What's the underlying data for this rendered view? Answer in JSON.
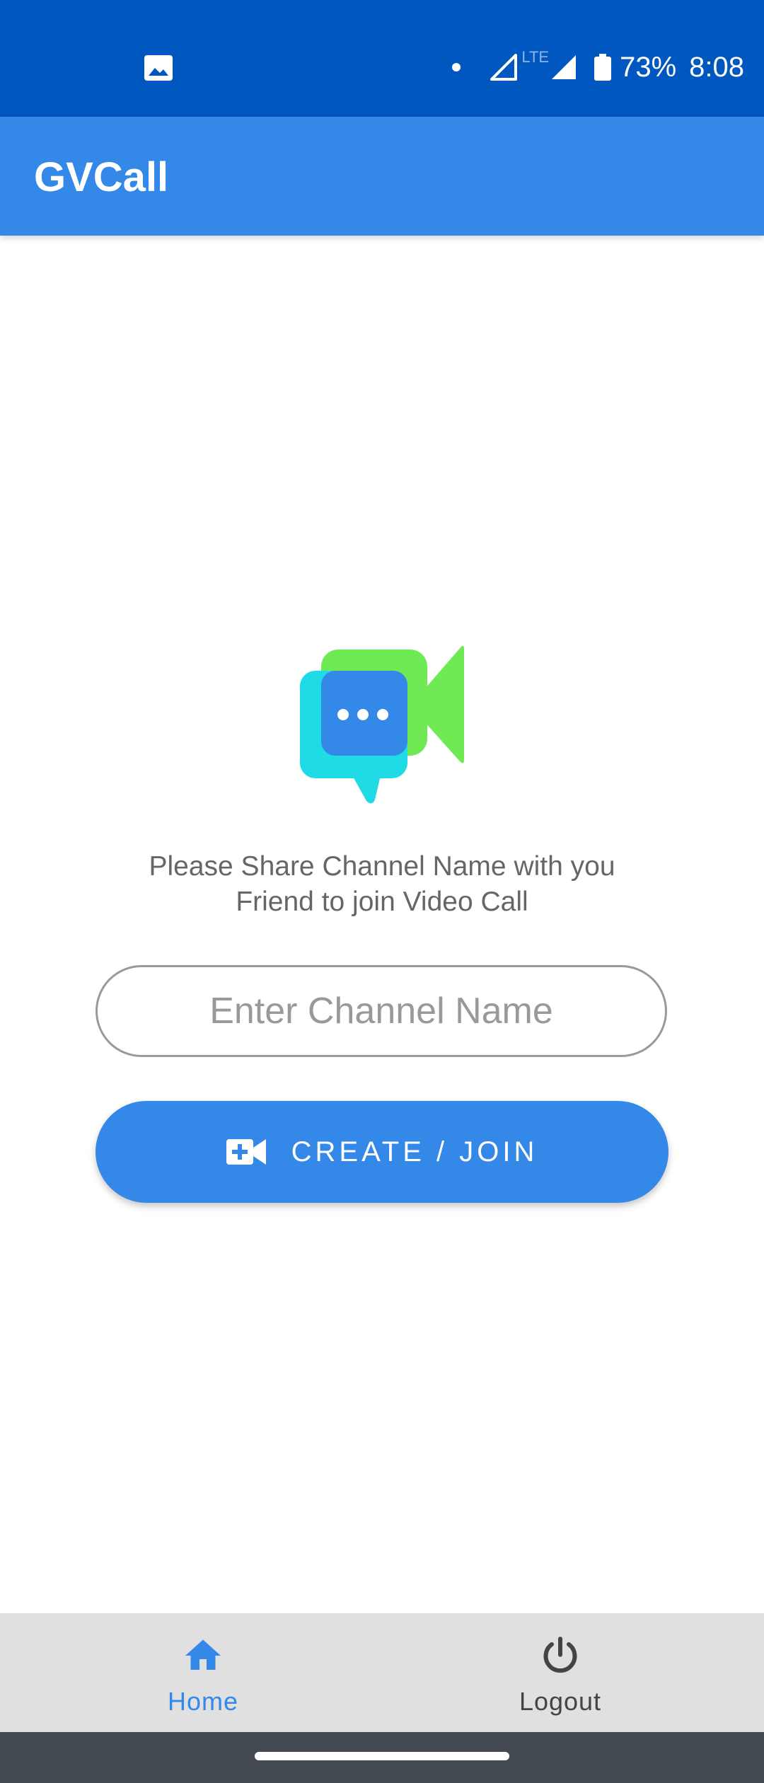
{
  "status_bar": {
    "network_type": "LTE",
    "battery_percent": "73%",
    "time": "8:08",
    "icons": [
      "gallery-icon",
      "notification-dot-icon",
      "cell-signal-icon",
      "cell-signal-icon",
      "battery-icon"
    ]
  },
  "app_bar": {
    "title": "GVCall"
  },
  "main": {
    "hero_icon": "video-chat-logo-icon",
    "instructions_line1": "Please Share Channel Name with you",
    "instructions_line2": "Friend to join Video Call",
    "channel_input": {
      "placeholder": "Enter Channel Name",
      "value": ""
    },
    "join_button": {
      "icon": "video-call-add-icon",
      "label": "CREATE / JOIN"
    }
  },
  "bottom_nav": {
    "items": [
      {
        "label": "Home",
        "icon": "home-icon",
        "selected": true
      },
      {
        "label": "Logout",
        "icon": "power-icon",
        "selected": false
      }
    ]
  },
  "colors": {
    "status_bar": "#0057c0",
    "primary": "#3388e8",
    "logo_green": "#6fea55",
    "logo_cyan": "#1fdbe6",
    "bottom_nav_bg": "#e0e0e0",
    "system_nav_bg": "#434951"
  }
}
